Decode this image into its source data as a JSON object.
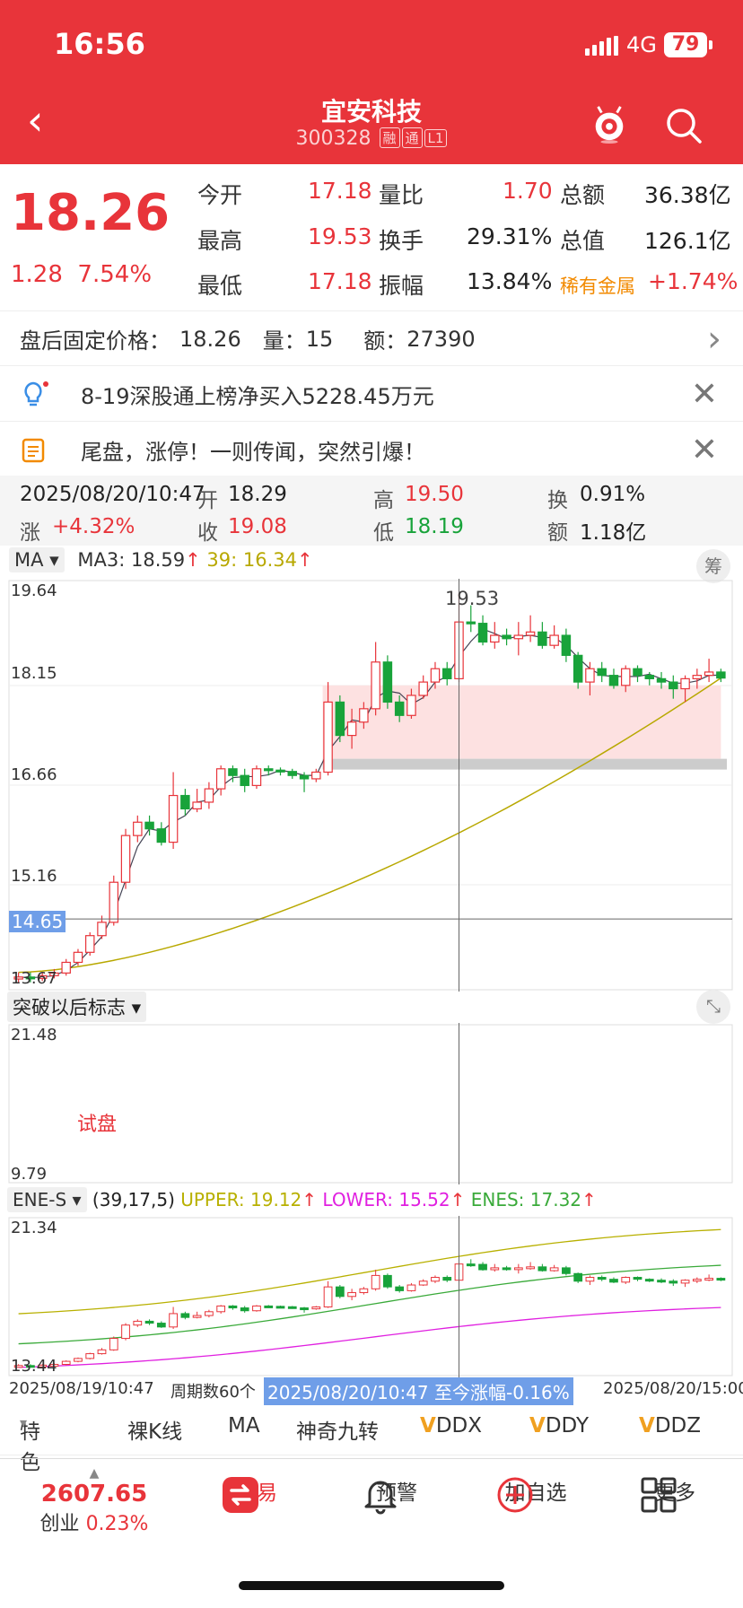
{
  "status_bar": {
    "time": "16:56",
    "network": "4G",
    "battery": "79"
  },
  "header": {
    "title": "宜安科技",
    "code": "300328",
    "tags": [
      "融",
      "通",
      "L1"
    ]
  },
  "quote": {
    "price": "18.26",
    "change": "1.28",
    "change_pct": "7.54%",
    "labels": {
      "open": "今开",
      "high": "最高",
      "low": "最低",
      "vol_ratio": "量比",
      "turnover": "换手",
      "amplitude": "振幅",
      "amount": "总额",
      "market_cap": "总值",
      "sector": "稀有金属"
    },
    "values": {
      "open": "17.18",
      "high": "19.53",
      "low": "17.18",
      "vol_ratio": "1.70",
      "turnover": "29.31%",
      "amplitude": "13.84%",
      "amount": "36.38亿",
      "market_cap": "126.1亿",
      "sector_pct": "+1.74%"
    }
  },
  "after_hours": {
    "label": "盘后固定价格：",
    "price": "18.26",
    "vol_label": "量：",
    "vol": "15",
    "amt_label": "额：",
    "amt": "27390"
  },
  "notices": [
    {
      "text": "8-19深股通上榜净买入5228.45万元",
      "icon": "lightbulb-icon"
    },
    {
      "text": "尾盘，涨停！一则传闻，突然引爆！",
      "icon": "document-icon"
    }
  ],
  "kline_info": {
    "datetime": "2025/08/20/10:47",
    "open_label": "开",
    "open": "18.29",
    "high_label": "高",
    "high": "19.50",
    "turn_label": "换",
    "turn": "0.91%",
    "chg_label": "涨",
    "chg": "+4.32%",
    "close_label": "收",
    "close": "19.08",
    "low_label": "低",
    "low": "18.19",
    "amt_label": "额",
    "amt": "1.18亿"
  },
  "ma_bar": {
    "selector": "MA",
    "ma3_label": "MA3: 18.59",
    "ma39_label": "39: 16.34",
    "chip_btn": "筹"
  },
  "main_chart": {
    "y_labels": [
      "19.64",
      "18.15",
      "16.66",
      "15.16",
      "13.67"
    ],
    "crosshair_price": "14.65",
    "max_label": "19.53"
  },
  "indicator1": {
    "selector": "突破以后标志",
    "y_top": "21.48",
    "y_bottom": "9.79",
    "annotation": "试盘"
  },
  "indicator2": {
    "selector": "ENE-S",
    "params": "(39,17,5)",
    "upper": "UPPER: 19.12",
    "lower": "LOWER: 15.52",
    "enes": "ENES: 17.32",
    "y_top": "21.34",
    "y_bottom": "13.44"
  },
  "time_axis": {
    "start": "2025/08/19/10:47",
    "period": "周期数60个",
    "highlight": "2025/08/20/10:47 至今涨幅-0.16%",
    "end": "2025/08/20/15:00"
  },
  "tabs": [
    "特色",
    "裸K线",
    "MA",
    "神奇九转",
    "DDX",
    "DDY",
    "DDZ"
  ],
  "bottom_nav": {
    "index_value": "2607.65",
    "index_name": "创业",
    "index_pct": "0.23%",
    "trade": "交易",
    "alert": "预警",
    "add": "加自选",
    "more": "更多"
  },
  "colors": {
    "red": "#e8343a",
    "green": "#18a33a",
    "ma39": "#b8a800",
    "ene_upper": "#b8b000",
    "ene_lower": "#e020e0",
    "ene_mid": "#3aaa3a"
  },
  "chart_data": {
    "type": "candlestick",
    "y_range": [
      13.67,
      19.64
    ],
    "candles": [
      [
        13.75,
        13.78,
        13.7,
        13.85
      ],
      [
        13.78,
        13.76,
        13.7,
        13.85
      ],
      [
        13.76,
        13.8,
        13.72,
        13.85
      ],
      [
        13.8,
        13.84,
        13.76,
        13.9
      ],
      [
        13.84,
        14.0,
        13.8,
        14.05
      ],
      [
        14.0,
        14.15,
        13.95,
        14.2
      ],
      [
        14.15,
        14.4,
        14.1,
        14.45
      ],
      [
        14.4,
        14.6,
        14.35,
        14.7
      ],
      [
        14.6,
        15.2,
        14.55,
        15.3
      ],
      [
        15.2,
        15.9,
        15.1,
        16.0
      ],
      [
        15.9,
        16.1,
        15.8,
        16.2
      ],
      [
        16.1,
        16.0,
        15.9,
        16.2
      ],
      [
        16.0,
        15.8,
        15.75,
        16.1
      ],
      [
        15.8,
        16.5,
        15.7,
        16.85
      ],
      [
        16.5,
        16.3,
        16.2,
        16.6
      ],
      [
        16.3,
        16.4,
        16.25,
        16.6
      ],
      [
        16.4,
        16.6,
        16.3,
        16.7
      ],
      [
        16.6,
        16.9,
        16.5,
        16.95
      ],
      [
        16.9,
        16.8,
        16.7,
        16.95
      ],
      [
        16.8,
        16.65,
        16.55,
        16.9
      ],
      [
        16.65,
        16.9,
        16.6,
        16.95
      ],
      [
        16.9,
        16.88,
        16.8,
        16.95
      ],
      [
        16.88,
        16.86,
        16.8,
        16.92
      ],
      [
        16.86,
        16.8,
        16.75,
        16.9
      ],
      [
        16.8,
        16.75,
        16.55,
        16.85
      ],
      [
        16.75,
        16.85,
        16.7,
        16.9
      ],
      [
        16.85,
        17.9,
        16.8,
        18.2
      ],
      [
        17.9,
        17.4,
        17.3,
        18.0
      ],
      [
        17.4,
        17.6,
        17.2,
        17.8
      ],
      [
        17.6,
        17.8,
        17.5,
        17.9
      ],
      [
        17.8,
        18.5,
        17.7,
        18.8
      ],
      [
        18.5,
        17.9,
        17.8,
        18.6
      ],
      [
        17.9,
        17.7,
        17.6,
        18.0
      ],
      [
        17.7,
        18.0,
        17.65,
        18.1
      ],
      [
        18.0,
        18.2,
        17.95,
        18.3
      ],
      [
        18.2,
        18.4,
        18.1,
        18.5
      ],
      [
        18.4,
        18.25,
        18.15,
        18.5
      ],
      [
        18.25,
        19.1,
        18.2,
        19.53
      ],
      [
        19.1,
        19.08,
        18.95,
        19.35
      ],
      [
        19.08,
        18.8,
        18.75,
        19.2
      ],
      [
        18.8,
        18.9,
        18.7,
        19.1
      ],
      [
        18.9,
        18.85,
        18.75,
        19.0
      ],
      [
        18.85,
        18.9,
        18.6,
        19.1
      ],
      [
        18.9,
        18.95,
        18.8,
        19.2
      ],
      [
        18.95,
        18.75,
        18.7,
        19.1
      ],
      [
        18.75,
        18.9,
        18.7,
        19.05
      ],
      [
        18.9,
        18.6,
        18.5,
        19.0
      ],
      [
        18.6,
        18.2,
        18.1,
        18.65
      ],
      [
        18.2,
        18.4,
        18.0,
        18.5
      ],
      [
        18.4,
        18.3,
        18.2,
        18.5
      ],
      [
        18.3,
        18.15,
        18.1,
        18.4
      ],
      [
        18.15,
        18.4,
        18.05,
        18.45
      ],
      [
        18.4,
        18.3,
        18.2,
        18.45
      ],
      [
        18.3,
        18.25,
        18.15,
        18.35
      ],
      [
        18.25,
        18.2,
        18.1,
        18.35
      ],
      [
        18.2,
        18.1,
        17.95,
        18.3
      ],
      [
        18.1,
        18.25,
        17.9,
        18.3
      ],
      [
        18.25,
        18.3,
        18.1,
        18.4
      ],
      [
        18.3,
        18.35,
        18.2,
        18.55
      ],
      [
        18.35,
        18.26,
        18.2,
        18.4
      ]
    ]
  }
}
